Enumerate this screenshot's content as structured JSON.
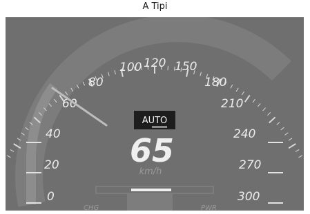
{
  "caption": "A Tipi",
  "speedometer": {
    "tick_labels": [
      "0",
      "20",
      "40",
      "60",
      "80",
      "100",
      "120",
      "150",
      "180",
      "210",
      "240",
      "270",
      "300"
    ],
    "speed_value": "65",
    "speed_unit": "km/h",
    "mode_badge": "AUTO",
    "charge_label": "CHG",
    "power_label": "PWR",
    "needle_speed": 65,
    "colors": {
      "face": "#6f6f6f",
      "ticks": "#d9d9d9",
      "text": "#ececec",
      "badge": "#1d1d1d"
    }
  }
}
